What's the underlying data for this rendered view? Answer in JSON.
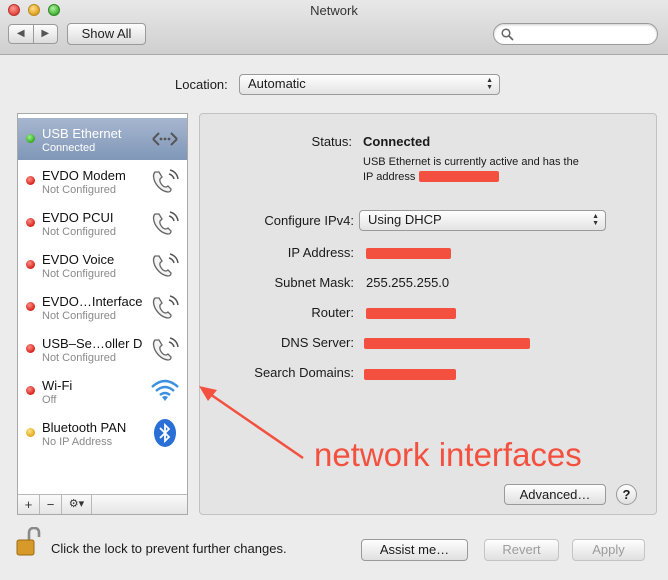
{
  "window": {
    "title": "Network"
  },
  "toolbar": {
    "back": "◀",
    "forward": "▶",
    "show_all": "Show All",
    "search_placeholder": ""
  },
  "location": {
    "label": "Location:",
    "value": "Automatic"
  },
  "services": [
    {
      "name": "USB Ethernet",
      "status": "Connected",
      "dot": "green",
      "icon": "ethernet-icon",
      "selected": true
    },
    {
      "name": "EVDO Modem",
      "status": "Not Configured",
      "dot": "red",
      "icon": "phone-icon"
    },
    {
      "name": "EVDO PCUI",
      "status": "Not Configured",
      "dot": "red",
      "icon": "phone-icon"
    },
    {
      "name": "EVDO Voice",
      "status": "Not Configured",
      "dot": "red",
      "icon": "phone-icon"
    },
    {
      "name": "EVDO…Interface",
      "status": "Not Configured",
      "dot": "red",
      "icon": "phone-icon"
    },
    {
      "name": "USB–Se…oller D",
      "status": "Not Configured",
      "dot": "red",
      "icon": "phone-icon"
    },
    {
      "name": "Wi-Fi",
      "status": "Off",
      "dot": "red",
      "icon": "wifi-icon"
    },
    {
      "name": "Bluetooth PAN",
      "status": "No IP Address",
      "dot": "yellow",
      "icon": "bluetooth-icon"
    }
  ],
  "sidebar_controls": {
    "add": "+",
    "remove": "−",
    "gear": "⚙▾"
  },
  "detail": {
    "status_label": "Status:",
    "status_value": "Connected",
    "status_desc_line1": "USB Ethernet is currently active and has the",
    "status_desc_line2": "IP address",
    "configure_label": "Configure IPv4:",
    "configure_value": "Using DHCP",
    "ip_label": "IP Address:",
    "subnet_label": "Subnet Mask:",
    "subnet_value": "255.255.255.0",
    "router_label": "Router:",
    "dns_label": "DNS Server:",
    "search_domains_label": "Search Domains:",
    "advanced_button": "Advanced…",
    "help_button": "?"
  },
  "footer": {
    "lock_text": "Click the lock to prevent further changes.",
    "assist_button": "Assist me…",
    "revert_button": "Revert",
    "apply_button": "Apply"
  },
  "annotation": {
    "text": "network interfaces",
    "color": "#f4503f"
  },
  "colors": {
    "selection": "#8a9fc0",
    "redaction": "#f4503f"
  }
}
